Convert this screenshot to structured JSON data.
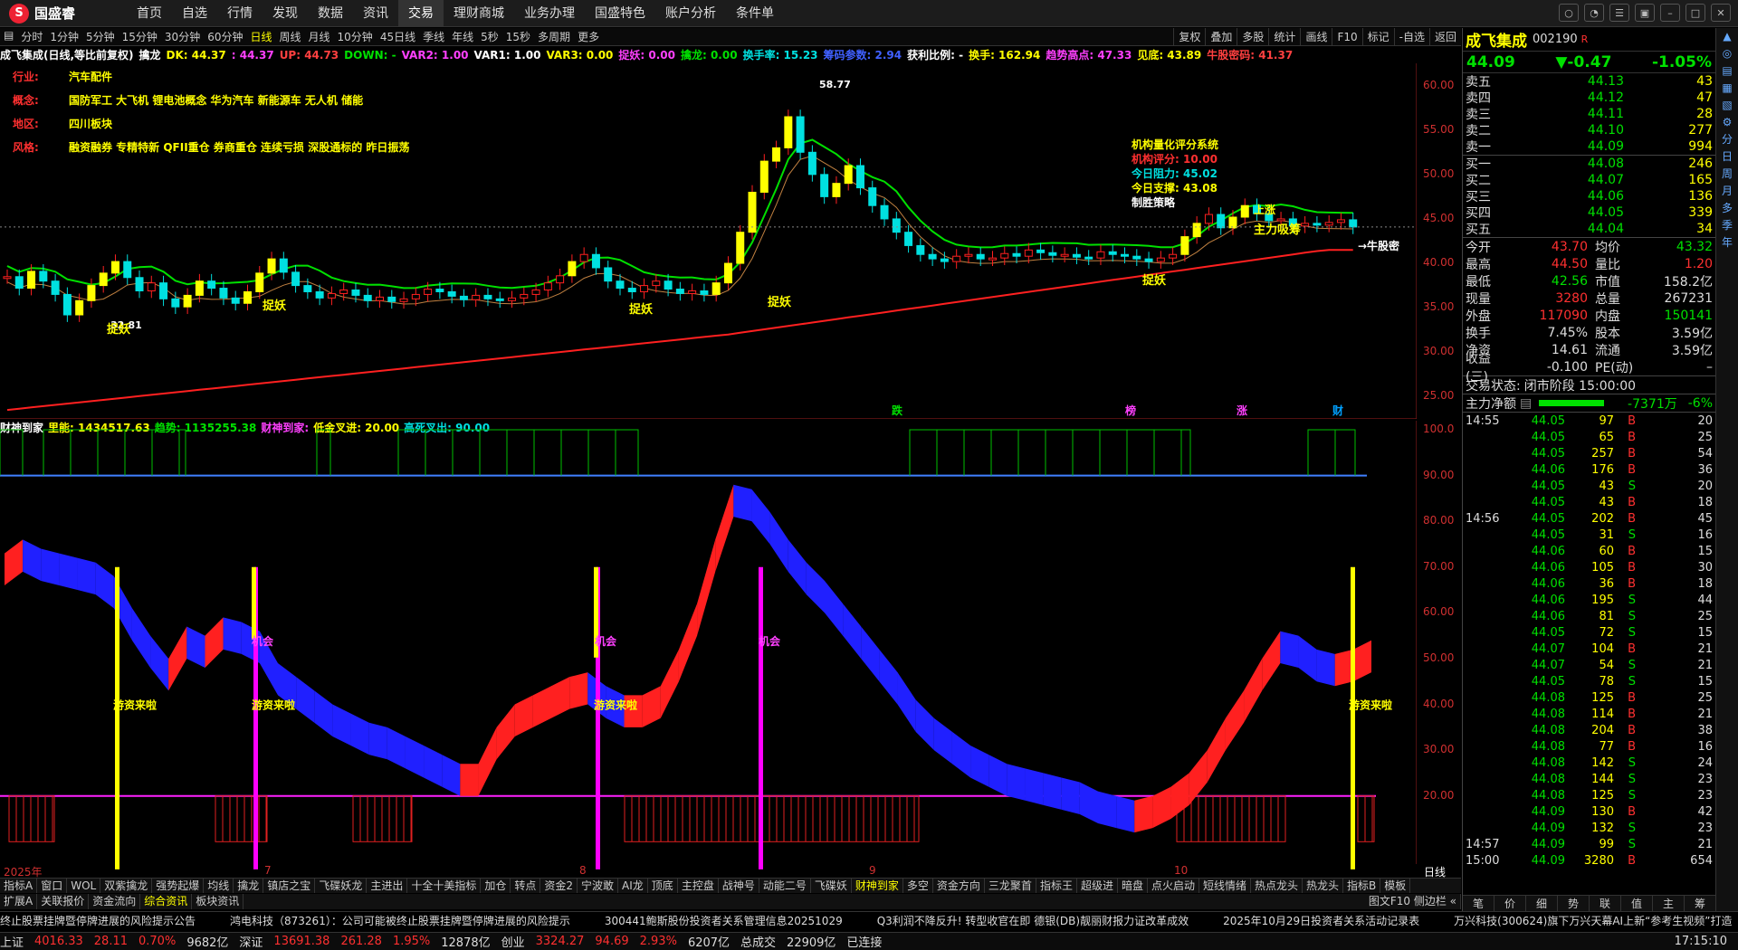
{
  "app": {
    "logo": "国盛睿"
  },
  "menu": [
    "首页",
    "自选",
    "行情",
    "发现",
    "数据",
    "资讯",
    "交易",
    "理财商城",
    "业务办理",
    "国盛特色",
    "账户分析",
    "条件单"
  ],
  "active_menu": "交易",
  "periods": [
    "分时",
    "1分钟",
    "5分钟",
    "15分钟",
    "30分钟",
    "60分钟",
    "日线",
    "周线",
    "月线",
    "10分钟",
    "45日线",
    "季线",
    "年线",
    "5秒",
    "15秒",
    "多周期",
    "更多"
  ],
  "active_period": "日线",
  "toolbar_right": [
    "复权",
    "叠加",
    "多股",
    "统计",
    "画线",
    "F10",
    "标记",
    "-自选",
    "返回"
  ],
  "indicator_line": [
    {
      "t": "成飞集成(日线,等比前复权)",
      "c": "#ffffff"
    },
    {
      "t": "擒龙",
      "c": "#ffffff"
    },
    {
      "t": "DK: 44.37",
      "c": "#ffff00"
    },
    {
      "t": ": 44.37",
      "c": "#ff40ff"
    },
    {
      "t": "UP: 44.73",
      "c": "#ff4040"
    },
    {
      "t": "DOWN: -",
      "c": "#00e000"
    },
    {
      "t": "VAR2: 1.00",
      "c": "#ff40ff"
    },
    {
      "t": "VAR1: 1.00",
      "c": "#ffffff"
    },
    {
      "t": "VAR3: 0.00",
      "c": "#ffff00"
    },
    {
      "t": "捉妖: 0.00",
      "c": "#ff40ff"
    },
    {
      "t": "擒龙: 0.00",
      "c": "#00e000"
    },
    {
      "t": "换手率: 15.23",
      "c": "#00e0e0"
    },
    {
      "t": "筹码参数: 2.94",
      "c": "#4060ff"
    },
    {
      "t": "获利比例: -",
      "c": "#ffffff"
    },
    {
      "t": "换手: 162.94",
      "c": "#ffff00"
    },
    {
      "t": "趋势高点: 47.33",
      "c": "#ff40ff"
    },
    {
      "t": "见底: 43.89",
      "c": "#ffff00"
    },
    {
      "t": "牛股密码: 41.37",
      "c": "#ff4040"
    }
  ],
  "info": [
    {
      "k": "行业:",
      "v": "汽车配件"
    },
    {
      "k": "概念:",
      "v": "国防军工 大飞机 锂电池概念 华为汽车 新能源车 无人机 储能"
    },
    {
      "k": "地区:",
      "v": "四川板块"
    },
    {
      "k": "风格:",
      "v": "融资融券 专精特新 QFII重仓 券商重仓 连续亏损 深股通标的 昨日振荡"
    }
  ],
  "scoring": {
    "title": "机构量化评分系统",
    "score_label": "机构评分: ",
    "score": "10.00",
    "res_label": "今日阻力: ",
    "res": "45.02",
    "sup_label": "今日支撑: ",
    "sup": "43.08",
    "status": "制胜策略"
  },
  "annotations": {
    "peak": "58.77",
    "low": "32.81",
    "catch": "捉妖",
    "main_funds": "主力吸筹",
    "niu": "→牛股密",
    "rise": "上涨"
  },
  "main_axis": [
    "60.00",
    "55.00",
    "50.00",
    "45.00",
    "40.00",
    "35.00",
    "30.00",
    "25.00"
  ],
  "sub_header": [
    {
      "t": "财神到家",
      "c": "#ffffff"
    },
    {
      "t": "里能: 1434517.63",
      "c": "#ffff00"
    },
    {
      "t": "趋势: 1135255.38",
      "c": "#00e000"
    },
    {
      "t": "财神到家:",
      "c": "#ff40ff"
    },
    {
      "t": "低金叉进: 20.00",
      "c": "#ffff00"
    },
    {
      "t": "高死叉出: 90.00",
      "c": "#00e0e0"
    }
  ],
  "sub_axis": [
    "100.0",
    "90.00",
    "80.00",
    "70.00",
    "60.00",
    "50.00",
    "40.00",
    "30.00",
    "20.00"
  ],
  "sub_labels": {
    "youzi": "游资来啦",
    "jihui": "机会"
  },
  "markers": {
    "die": "跌",
    "bang": "榜",
    "zhang": "涨",
    "cai": "财"
  },
  "dates": [
    "2025年",
    "7",
    "8",
    "9",
    "10"
  ],
  "period_label": "日线",
  "indicator_tabs": [
    "指标A",
    "窗口",
    "WOL",
    "双紫擒龙",
    "强势起爆",
    "均线",
    "擒龙",
    "镇店之宝",
    "飞碟妖龙",
    "主进出",
    "十全十美指标",
    "加仓",
    "转点",
    "资金2",
    "宁波敢",
    "AI龙",
    "顶底",
    "主控盘",
    "战神号",
    "动能二号",
    "飞碟妖",
    "财神到家",
    "多空",
    "资金方向",
    "三龙聚首",
    "指标王",
    "超级进",
    "暗盘",
    "点火启动",
    "短线情绪",
    "热点龙头",
    "热龙头",
    "指标B",
    "模板"
  ],
  "active_indicator": "财神到家",
  "sub_tabs": [
    "扩展A",
    "关联报价",
    "资金流向",
    "综合资讯",
    "板块资讯"
  ],
  "active_sub_tab": "综合资讯",
  "sub_tabs_right": "图文F10 侧边栏 «",
  "news": [
    "终止股票挂牌暨停牌进展的风险提示公告",
    "鸿电科技（873261）：公司可能被终止股票挂牌暨停牌进展的风险提示",
    "300441鲍斯股份投资者关系管理信息20251029",
    "Q3利润不降反升! 转型收官在即 德银(DB)靓丽财报力证改革成效",
    "2025年10月29日投资者关系活动记录表",
    "万兴科技(300624)旗下万兴天幕AI上新“参考生视频”打造"
  ],
  "status": [
    {
      "t": "上证",
      "c": "#ddd"
    },
    {
      "t": "4016.33",
      "c": "#ff3030"
    },
    {
      "t": "28.11",
      "c": "#ff3030"
    },
    {
      "t": "0.70%",
      "c": "#ff3030"
    },
    {
      "t": "9682亿",
      "c": "#ddd"
    },
    {
      "t": "深证",
      "c": "#ddd"
    },
    {
      "t": "13691.38",
      "c": "#ff3030"
    },
    {
      "t": "261.28",
      "c": "#ff3030"
    },
    {
      "t": "1.95%",
      "c": "#ff3030"
    },
    {
      "t": "12878亿",
      "c": "#ddd"
    },
    {
      "t": "创业",
      "c": "#ddd"
    },
    {
      "t": "3324.27",
      "c": "#ff3030"
    },
    {
      "t": "94.69",
      "c": "#ff3030"
    },
    {
      "t": "2.93%",
      "c": "#ff3030"
    },
    {
      "t": "6207亿",
      "c": "#ddd"
    },
    {
      "t": "总成交",
      "c": "#ddd"
    },
    {
      "t": "22909亿",
      "c": "#ddd"
    },
    {
      "t": "已连接",
      "c": "#ddd"
    }
  ],
  "clock": "17:15:10",
  "stock": {
    "name": "成飞集成",
    "code": "002190",
    "flag": "R",
    "price": "44.09",
    "change": "▼-0.47",
    "pct": "-1.05%"
  },
  "asks": [
    {
      "l": "卖五",
      "p": "44.13",
      "v": "43"
    },
    {
      "l": "卖四",
      "p": "44.12",
      "v": "47"
    },
    {
      "l": "卖三",
      "p": "44.11",
      "v": "28"
    },
    {
      "l": "卖二",
      "p": "44.10",
      "v": "277"
    },
    {
      "l": "卖一",
      "p": "44.09",
      "v": "994"
    }
  ],
  "bids": [
    {
      "l": "买一",
      "p": "44.08",
      "v": "246"
    },
    {
      "l": "买二",
      "p": "44.07",
      "v": "165"
    },
    {
      "l": "买三",
      "p": "44.06",
      "v": "136"
    },
    {
      "l": "买四",
      "p": "44.05",
      "v": "339"
    },
    {
      "l": "买五",
      "p": "44.04",
      "v": "34"
    }
  ],
  "stats": [
    {
      "l": "今开",
      "v": "43.70",
      "vc": "red",
      "l2": "均价",
      "v2": "43.32",
      "v2c": "green"
    },
    {
      "l": "最高",
      "v": "44.50",
      "vc": "red",
      "l2": "量比",
      "v2": "1.20",
      "v2c": "red"
    },
    {
      "l": "最低",
      "v": "42.56",
      "vc": "green",
      "l2": "市值",
      "v2": "158.2亿",
      "v2c": "white"
    },
    {
      "l": "现量",
      "v": "3280",
      "vc": "red",
      "l2": "总量",
      "v2": "267231",
      "v2c": "white"
    },
    {
      "l": "外盘",
      "v": "117090",
      "vc": "red",
      "l2": "内盘",
      "v2": "150141",
      "v2c": "green"
    },
    {
      "l": "换手",
      "v": "7.45%",
      "vc": "white",
      "l2": "股本",
      "v2": "3.59亿",
      "v2c": "white"
    },
    {
      "l": "净资",
      "v": "14.61",
      "vc": "white",
      "l2": "流通",
      "v2": "3.59亿",
      "v2c": "white"
    },
    {
      "l": "收益(三)",
      "v": "-0.100",
      "vc": "white",
      "l2": "PE(动)",
      "v2": "–",
      "v2c": "white"
    }
  ],
  "trade_state": {
    "label": "交易状态:",
    "value": "闭市阶段 15:00:00"
  },
  "net_flow": {
    "label": "主力净额",
    "value": "-7371万",
    "pct": "-6%"
  },
  "ticks": [
    {
      "t": "14:55",
      "p": "44.05",
      "v": "97",
      "d": "B",
      "n": "20"
    },
    {
      "t": "",
      "p": "44.05",
      "v": "65",
      "d": "B",
      "n": "25"
    },
    {
      "t": "",
      "p": "44.05",
      "v": "257",
      "d": "B",
      "n": "54"
    },
    {
      "t": "",
      "p": "44.06",
      "v": "176",
      "d": "B",
      "n": "36"
    },
    {
      "t": "",
      "p": "44.05",
      "v": "43",
      "d": "S",
      "n": "20"
    },
    {
      "t": "",
      "p": "44.05",
      "v": "43",
      "d": "B",
      "n": "18"
    },
    {
      "t": "14:56",
      "p": "44.05",
      "v": "202",
      "d": "B",
      "n": "45"
    },
    {
      "t": "",
      "p": "44.05",
      "v": "31",
      "d": "S",
      "n": "16"
    },
    {
      "t": "",
      "p": "44.06",
      "v": "60",
      "d": "B",
      "n": "15"
    },
    {
      "t": "",
      "p": "44.06",
      "v": "105",
      "d": "B",
      "n": "30"
    },
    {
      "t": "",
      "p": "44.06",
      "v": "36",
      "d": "B",
      "n": "18"
    },
    {
      "t": "",
      "p": "44.06",
      "v": "195",
      "d": "S",
      "n": "44"
    },
    {
      "t": "",
      "p": "44.06",
      "v": "81",
      "d": "S",
      "n": "25"
    },
    {
      "t": "",
      "p": "44.05",
      "v": "72",
      "d": "S",
      "n": "15"
    },
    {
      "t": "",
      "p": "44.07",
      "v": "104",
      "d": "B",
      "n": "21"
    },
    {
      "t": "",
      "p": "44.07",
      "v": "54",
      "d": "S",
      "n": "21"
    },
    {
      "t": "",
      "p": "44.05",
      "v": "78",
      "d": "S",
      "n": "15"
    },
    {
      "t": "",
      "p": "44.08",
      "v": "125",
      "d": "B",
      "n": "25"
    },
    {
      "t": "",
      "p": "44.08",
      "v": "114",
      "d": "B",
      "n": "21"
    },
    {
      "t": "",
      "p": "44.08",
      "v": "204",
      "d": "B",
      "n": "38"
    },
    {
      "t": "",
      "p": "44.08",
      "v": "77",
      "d": "B",
      "n": "16"
    },
    {
      "t": "",
      "p": "44.08",
      "v": "142",
      "d": "S",
      "n": "24"
    },
    {
      "t": "",
      "p": "44.08",
      "v": "144",
      "d": "S",
      "n": "23"
    },
    {
      "t": "",
      "p": "44.08",
      "v": "125",
      "d": "S",
      "n": "23"
    },
    {
      "t": "",
      "p": "44.09",
      "v": "130",
      "d": "B",
      "n": "42"
    },
    {
      "t": "",
      "p": "44.09",
      "v": "132",
      "d": "S",
      "n": "23"
    },
    {
      "t": "14:57",
      "p": "44.09",
      "v": "99",
      "d": "S",
      "n": "21"
    },
    {
      "t": "15:00",
      "p": "44.09",
      "v": "3280",
      "d": "B",
      "n": "654"
    }
  ],
  "panel_tabs": [
    "笔",
    "价",
    "细",
    "势",
    "联",
    "值",
    "主",
    "筹"
  ],
  "sidebar": [
    "分",
    "日",
    "周",
    "月",
    "多",
    "季",
    "年"
  ],
  "chart_data": {
    "type": "candlestick",
    "title": "成飞集成(日线,等比前复权)",
    "ylim": [
      23,
      62
    ],
    "series_close": [
      38.5,
      37.2,
      39.1,
      38.0,
      36.5,
      34.2,
      35.8,
      37.5,
      38.9,
      40.2,
      38.4,
      36.9,
      37.8,
      36.0,
      35.1,
      36.4,
      38.0,
      37.2,
      36.1,
      35.5,
      36.8,
      38.9,
      40.5,
      39.0,
      37.5,
      36.8,
      36.1,
      36.6,
      37.0,
      36.4,
      35.8,
      36.2,
      35.7,
      36.0,
      36.5,
      37.1,
      36.8,
      36.3,
      35.9,
      36.4,
      36.0,
      35.8,
      36.1,
      36.5,
      37.0,
      37.8,
      38.6,
      40.2,
      41.0,
      39.5,
      38.0,
      37.2,
      36.8,
      37.5,
      38.0,
      37.1,
      36.6,
      36.9,
      36.5,
      37.8,
      40.0,
      43.5,
      48.0,
      51.5,
      53.0,
      56.5,
      52.5,
      50.0,
      47.5,
      49.0,
      51.0,
      48.5,
      46.5,
      45.0,
      43.5,
      42.0,
      41.0,
      40.5,
      40.2,
      40.8,
      41.0,
      40.5,
      40.6,
      41.1,
      40.8,
      41.5,
      41.2,
      40.9,
      41.0,
      40.7,
      40.6,
      41.3,
      41.0,
      40.8,
      40.5,
      40.2,
      40.6,
      41.0,
      43.0,
      44.5,
      45.5,
      44.0,
      45.2,
      46.5,
      45.6,
      44.8,
      45.0,
      44.2,
      44.5,
      44.3,
      44.6,
      44.9,
      44.09
    ],
    "sub_upper": [
      73,
      76,
      74,
      73,
      72,
      71,
      68,
      61,
      55,
      50,
      57,
      55,
      59,
      58,
      56,
      49,
      46,
      43,
      40,
      38,
      36,
      35,
      33,
      31,
      29,
      27,
      27,
      35,
      40,
      42,
      44,
      46,
      47,
      44,
      42,
      42,
      44,
      52,
      62,
      76,
      88,
      87,
      82,
      76,
      71,
      67,
      62,
      57,
      52,
      47,
      41,
      37,
      34,
      31,
      29,
      27,
      26,
      25,
      24,
      23,
      21,
      20,
      19,
      20,
      22,
      25,
      30,
      37,
      43,
      50,
      56,
      55,
      52,
      51,
      52,
      54
    ]
  }
}
